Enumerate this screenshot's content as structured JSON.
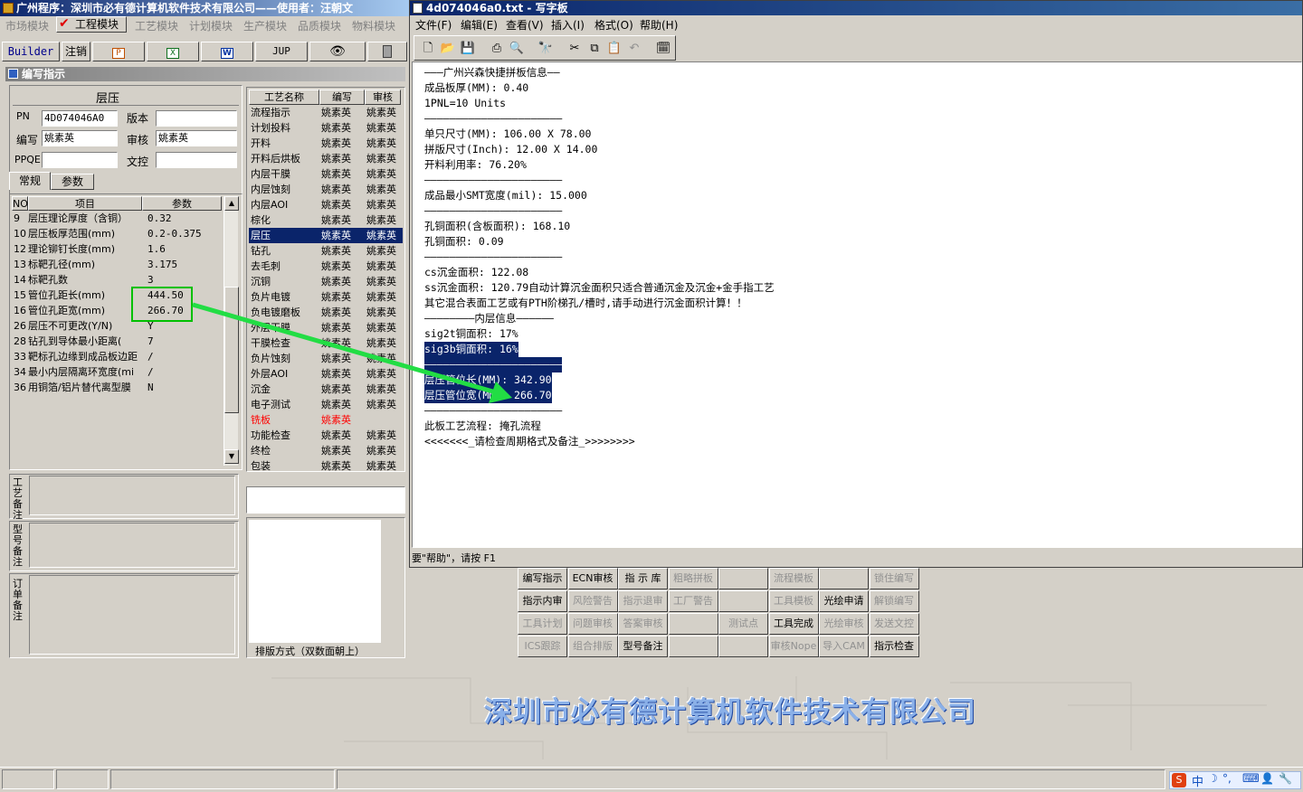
{
  "main_window": {
    "title": "广州程序：深圳市必有德计算机软件技术有限公司——使用者：汪朝文",
    "module_tabs": [
      "市场模块",
      "工程模块",
      "工艺模块",
      "计划模块",
      "生产模块",
      "品质模块",
      "物料模块"
    ],
    "active_module": "工程模块",
    "toolbar": {
      "builder": "Builder",
      "logout": "注销",
      "jup": "JUP"
    }
  },
  "panel": {
    "title": "编写指示",
    "section_header": "层压",
    "pn_label": "PN",
    "pn_value": "4D074046A0",
    "version_label": "版本",
    "version_value": "",
    "writer_label": "编写",
    "writer_value": "姚素英",
    "reviewer_label": "审核",
    "reviewer_value": "姚素英",
    "ppqe_label": "PPQE",
    "ppqe_value": "",
    "doc_label": "文控",
    "doc_value": "",
    "subtabs": [
      "常规",
      "参数"
    ],
    "param_headers": {
      "no": "NO",
      "item": "项目",
      "param": "参数"
    },
    "params": [
      {
        "no": "9",
        "item": "层压理论厚度（含铜）",
        "value": "0.32"
      },
      {
        "no": "10",
        "item": "层压板厚范围(mm)",
        "value": "0.2-0.375"
      },
      {
        "no": "12",
        "item": "理论铆钉长度(mm)",
        "value": "1.6"
      },
      {
        "no": "13",
        "item": "标靶孔径(mm)",
        "value": "3.175"
      },
      {
        "no": "14",
        "item": "标靶孔数",
        "value": "3"
      },
      {
        "no": "15",
        "item": "管位孔距长(mm)",
        "value": "444.50"
      },
      {
        "no": "16",
        "item": "管位孔距宽(mm)",
        "value": "266.70"
      },
      {
        "no": "26",
        "item": "层压不可更改(Y/N)",
        "value": "Y"
      },
      {
        "no": "28",
        "item": "钻孔到导体最小距离(",
        "value": "7"
      },
      {
        "no": "33",
        "item": "靶标孔边缘到成品板边距",
        "value": "/"
      },
      {
        "no": "34",
        "item": "最小内层隔离环宽度(mi",
        "value": "/"
      },
      {
        "no": "36",
        "item": "用铜箔/铝片替代离型膜",
        "value": "N"
      }
    ],
    "remark_labels": [
      "工艺备注",
      "型号备注",
      "订单备注"
    ],
    "layout_label": "排版方式（双数面朝上）"
  },
  "process_table": {
    "headers": [
      "工艺名称",
      "编写",
      "审核"
    ],
    "selected_index": 8,
    "rows": [
      {
        "name": "流程指示",
        "writer": "姚素英",
        "reviewer": "姚素英"
      },
      {
        "name": "计划投料",
        "writer": "姚素英",
        "reviewer": "姚素英"
      },
      {
        "name": "开料",
        "writer": "姚素英",
        "reviewer": "姚素英"
      },
      {
        "name": "开料后烘板",
        "writer": "姚素英",
        "reviewer": "姚素英"
      },
      {
        "name": "内层干膜",
        "writer": "姚素英",
        "reviewer": "姚素英"
      },
      {
        "name": "内层蚀刻",
        "writer": "姚素英",
        "reviewer": "姚素英"
      },
      {
        "name": "内层AOI",
        "writer": "姚素英",
        "reviewer": "姚素英"
      },
      {
        "name": "棕化",
        "writer": "姚素英",
        "reviewer": "姚素英"
      },
      {
        "name": "层压",
        "writer": "姚素英",
        "reviewer": "姚素英"
      },
      {
        "name": "钻孔",
        "writer": "姚素英",
        "reviewer": "姚素英"
      },
      {
        "name": "去毛刺",
        "writer": "姚素英",
        "reviewer": "姚素英"
      },
      {
        "name": "沉铜",
        "writer": "姚素英",
        "reviewer": "姚素英"
      },
      {
        "name": "负片电镀",
        "writer": "姚素英",
        "reviewer": "姚素英"
      },
      {
        "name": "负电镀磨板",
        "writer": "姚素英",
        "reviewer": "姚素英"
      },
      {
        "name": "外层干膜",
        "writer": "姚素英",
        "reviewer": "姚素英"
      },
      {
        "name": "干膜检查",
        "writer": "姚素英",
        "reviewer": "姚素英"
      },
      {
        "name": "负片蚀刻",
        "writer": "姚素英",
        "reviewer": "姚素英"
      },
      {
        "name": "外层AOI",
        "writer": "姚素英",
        "reviewer": "姚素英"
      },
      {
        "name": "沉金",
        "writer": "姚素英",
        "reviewer": "姚素英"
      },
      {
        "name": "电子测试",
        "writer": "姚素英",
        "reviewer": "姚素英"
      },
      {
        "name": "铣板",
        "writer": "姚素英",
        "reviewer": ""
      },
      {
        "name": "功能检查",
        "writer": "姚素英",
        "reviewer": "姚素英"
      },
      {
        "name": "终检",
        "writer": "姚素英",
        "reviewer": "姚素英"
      },
      {
        "name": "包装",
        "writer": "姚素英",
        "reviewer": "姚素英"
      }
    ],
    "red_row_index": 20
  },
  "notepad": {
    "title": "4d074046a0.txt - 写字板",
    "menu": [
      "文件(F)",
      "编辑(E)",
      "查看(V)",
      "插入(I)",
      "格式(O)",
      "帮助(H)"
    ],
    "status": "要\"帮助\"，请按 F1",
    "lines": [
      "———广州兴森快捷拼板信息——",
      "成品板厚(MM): 0.40",
      "1PNL=10 Units",
      "——————————————————————",
      "单只尺寸(MM): 106.00 X 78.00",
      "拼版尺寸(Inch): 12.00 X 14.00",
      "开料利用率: 76.20%",
      "——————————————————————",
      "成品最小SMT宽度(mil): 15.000",
      "——————————————————————",
      "孔铜面积(含板面积): 168.10",
      "孔铜面积: 0.09",
      "——————————————————————",
      "cs沉金面积: 122.08",
      "ss沉金面积: 120.79自动计算沉金面积只适合普通沉金及沉金+金手指工艺",
      "其它混合表面工艺或有PTH阶梯孔/槽时,请手动进行沉金面积计算！！",
      "————————内层信息——————",
      "sig2t铜面积: 17%",
      "sig3b铜面积: 16%",
      "——————————————————————",
      "层压管位长(MM): 342.90",
      "层压管位宽(MM): 266.70",
      "——————————————————————",
      "此板工艺流程: 掩孔流程",
      "<<<<<<<_请检查周期格式及备注_>>>>>>>>"
    ],
    "selected_lines": [
      18,
      19,
      20,
      21
    ]
  },
  "function_buttons": [
    {
      "label": "编写指示",
      "enabled": true
    },
    {
      "label": "ECN审核",
      "enabled": true
    },
    {
      "label": "指 示 库",
      "enabled": true
    },
    {
      "label": "粗略拼板",
      "enabled": false
    },
    {
      "label": "",
      "enabled": false
    },
    {
      "label": "流程模板",
      "enabled": false
    },
    {
      "label": "",
      "enabled": false
    },
    {
      "label": "锁住编写",
      "enabled": false
    },
    {
      "label": "指示内审",
      "enabled": true
    },
    {
      "label": "风险警告",
      "enabled": false
    },
    {
      "label": "指示退审",
      "enabled": false
    },
    {
      "label": "工厂警告",
      "enabled": false
    },
    {
      "label": "",
      "enabled": false
    },
    {
      "label": "工具模板",
      "enabled": false
    },
    {
      "label": "光绘申请",
      "enabled": true
    },
    {
      "label": "解锁编写",
      "enabled": false
    },
    {
      "label": "工具计划",
      "enabled": false
    },
    {
      "label": "问题审核",
      "enabled": false
    },
    {
      "label": "答案审核",
      "enabled": false
    },
    {
      "label": "",
      "enabled": false
    },
    {
      "label": "测试点",
      "enabled": false
    },
    {
      "label": "工具完成",
      "enabled": true
    },
    {
      "label": "光绘审核",
      "enabled": false
    },
    {
      "label": "发送文控",
      "enabled": false
    },
    {
      "label": "ICS跟踪",
      "enabled": false
    },
    {
      "label": "组合排版",
      "enabled": false
    },
    {
      "label": "型号备注",
      "enabled": true
    },
    {
      "label": "",
      "enabled": false
    },
    {
      "label": "",
      "enabled": false
    },
    {
      "label": "审核Nope",
      "enabled": false
    },
    {
      "label": "导入CAM",
      "enabled": false
    },
    {
      "label": "指示检查",
      "enabled": true
    }
  ],
  "company_banner": "深圳市必有德计算机软件技术有限公司",
  "colors": {
    "title_blue": "#0a246a",
    "highlight_green": "#00c000",
    "arrow_green": "#22dd44",
    "error_red": "#ff0000"
  },
  "icons": [
    "new-file-icon",
    "open-folder-icon",
    "save-icon",
    "print-icon",
    "print-preview-icon",
    "find-icon",
    "cut-icon",
    "copy-icon",
    "paste-icon",
    "undo-icon",
    "datetime-icon"
  ]
}
